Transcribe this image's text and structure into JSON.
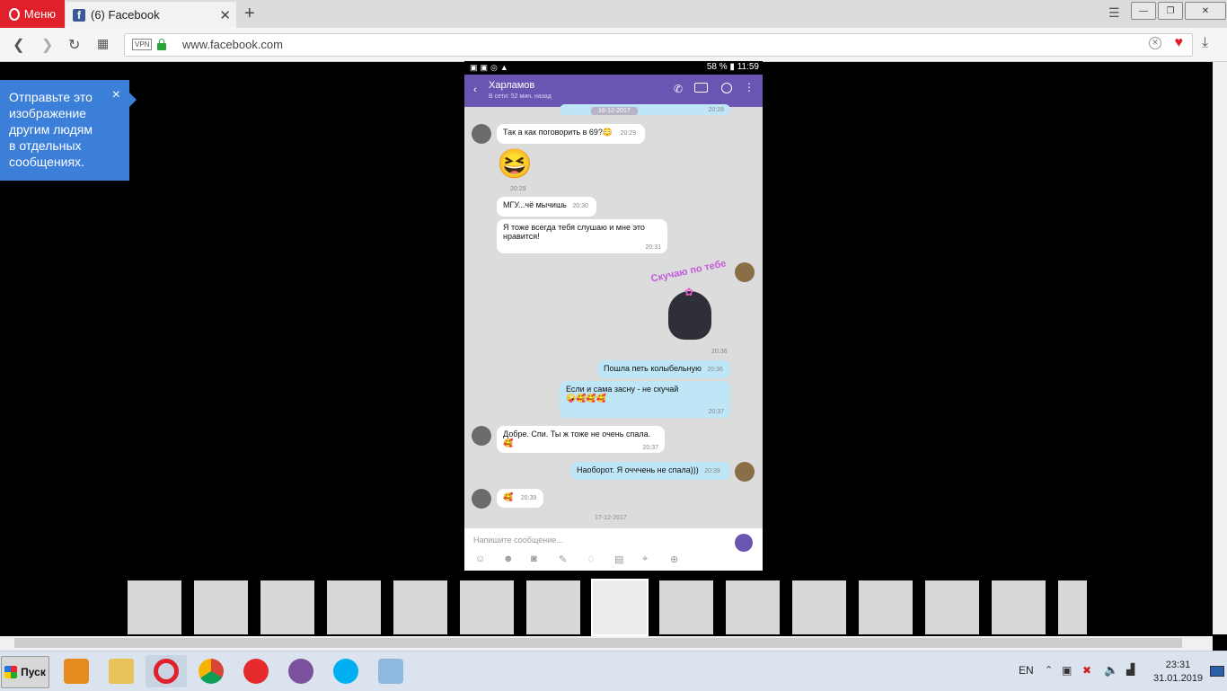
{
  "browser": {
    "menu_label": "Меню",
    "tab_title": "(6) Facebook",
    "fb_letter": "f",
    "url": "www.facebook.com",
    "vpn_badge": "VPN"
  },
  "tooltip": {
    "text": "Отправьте это изображение другим людям в отдельных сообщениях.",
    "close_glyph": "×"
  },
  "phone": {
    "status_right": "58 % ▮ 11:59",
    "contact_name": "Харламов",
    "last_seen": "В сети: 52 мин. назад",
    "date_top": "16-12-2017",
    "top_time": "20:28",
    "messages": [
      {
        "text": "Так а как поговорить в 69?😳",
        "time": "20:29"
      },
      {
        "text": "😆",
        "time": "20:29"
      },
      {
        "text": "МГУ...чё мычишь",
        "time": "20:30"
      },
      {
        "text": "Я тоже всегда тебя слушаю и мне это нравится!",
        "time": "20:31"
      },
      {
        "text": "Скучаю по тебе",
        "time": "20:36"
      },
      {
        "text": "Пошла петь колыбельную",
        "time": "20:36"
      },
      {
        "text": "Если и сама засну - не скучай 🤪🥰🥰🥰",
        "time": "20:37"
      },
      {
        "text": "Добре. Спи. Ты ж тоже не очень спала. 🥰",
        "time": "20:37"
      },
      {
        "text": "Наоборот. Я очччень не спала)))",
        "time": "20:39"
      },
      {
        "text": "🥰",
        "time": "20:39"
      }
    ],
    "date_bottom": "17-12-2017",
    "input_placeholder": "Напишите сообщение..."
  },
  "taskbar": {
    "start_label": "Пуск",
    "language": "EN",
    "time": "23:31",
    "date": "31.01.2019"
  },
  "colors": {
    "viber_purple": "#6a55b2",
    "opera_red": "#e0202a",
    "tooltip_blue": "#3b7fd9",
    "outgoing_bubble": "#bfe6f7"
  }
}
